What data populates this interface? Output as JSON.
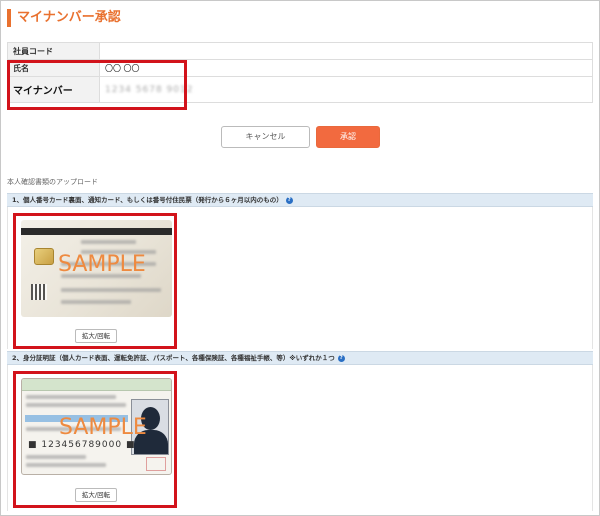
{
  "page": {
    "title": "マイナンバー承認"
  },
  "info_table": {
    "rows": [
      {
        "label": "社員コード",
        "value": ""
      },
      {
        "label": "氏名",
        "value": "〇〇 〇〇"
      },
      {
        "label": "マイナンバー",
        "value": "1234 5678 9012"
      }
    ]
  },
  "actions": {
    "cancel_label": "キャンセル",
    "approve_label": "承認"
  },
  "upload": {
    "section_title": "本人確認書類のアップロード",
    "sections": [
      {
        "heading": "1、個人番号カード裏面、通知カード、もしくは番号付住民票（発行から６ヶ月以内のもの）",
        "help_icon": "help-circle-icon",
        "sample_text": "SAMPLE",
        "button_label": "拡大/回転"
      },
      {
        "heading": "2、身分証明証（個人カード表面、運転免許証、パスポート、各種保険証、各種福祉手帳、等）※いずれか１つ",
        "help_icon": "help-circle-icon",
        "sample_text": "SAMPLE",
        "license_number": "■ 123456789000 ■",
        "button_label": "拡大/回転"
      }
    ]
  },
  "colors": {
    "accent": "#e9712f",
    "highlight_border": "#d2131b",
    "approve": "#f26a3f",
    "section_bar": "#dfeaf4"
  }
}
